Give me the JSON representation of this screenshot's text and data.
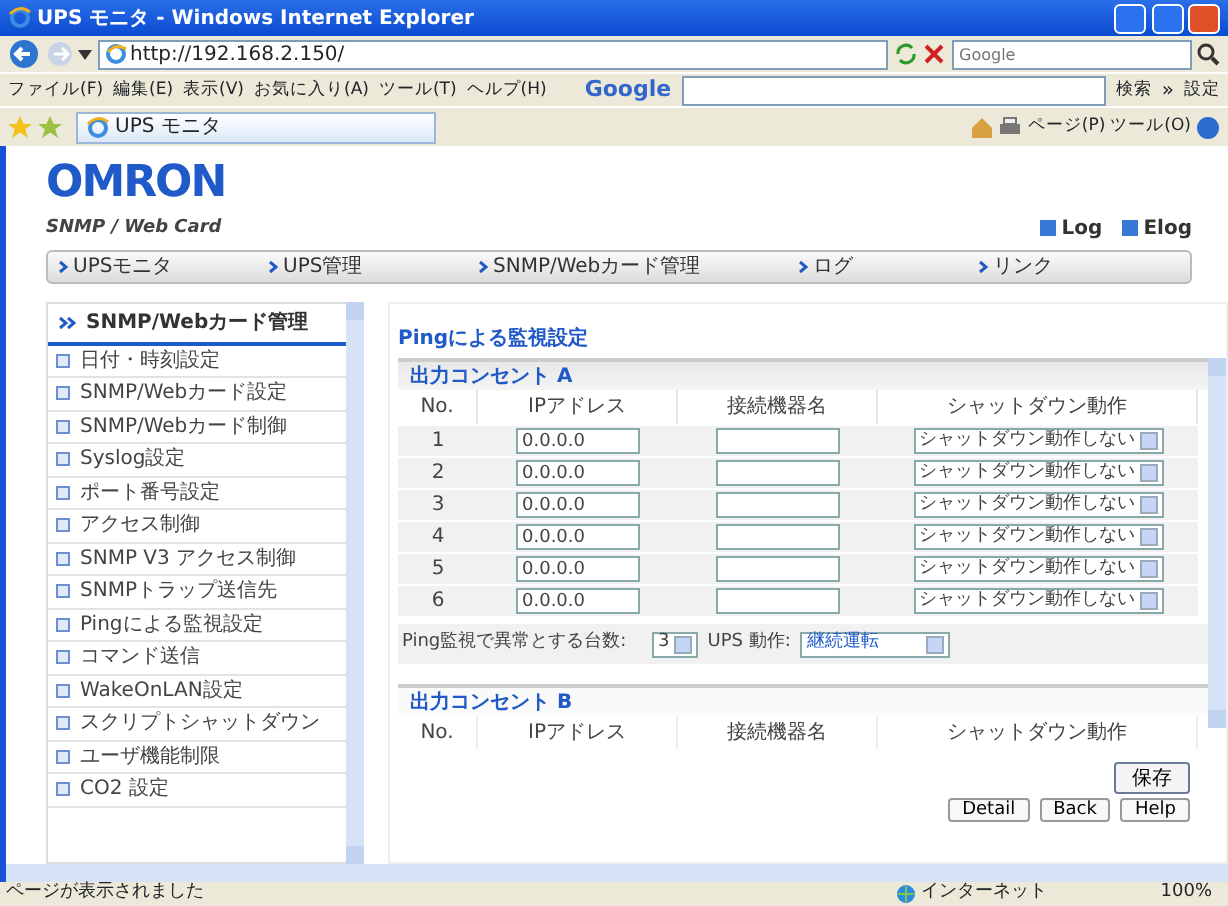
{
  "window": {
    "title": "UPS モニタ - Windows Internet Explorer"
  },
  "address_bar": {
    "url": "http://192.168.2.150/"
  },
  "search": {
    "placeholder": "Google"
  },
  "menu": [
    "ファイル(F)",
    "編集(E)",
    "表示(V)",
    "お気に入り(A)",
    "ツール(T)",
    "ヘルプ(H)"
  ],
  "google_toolbar": {
    "logo": "Google",
    "search_label": "検索",
    "chevron": "»",
    "settings": "設定"
  },
  "tab": {
    "title": "UPS モニタ"
  },
  "command_bar": [
    "ページ(P)",
    "ツール(O)"
  ],
  "page": {
    "logo": "OMRON",
    "subtitle": "SNMP / Web Card",
    "links": [
      "Log",
      "Elog"
    ],
    "nav": [
      "UPSモニタ",
      "UPS管理",
      "SNMP/Webカード管理",
      "ログ",
      "リンク"
    ],
    "sidebar": {
      "header": "SNMP/Webカード管理",
      "items": [
        "日付・時刻設定",
        "SNMP/Webカード設定",
        "SNMP/Webカード制御",
        "Syslog設定",
        "ポート番号設定",
        "アクセス制御",
        "SNMP V3 アクセス制御",
        "SNMPトラップ送信先",
        "Pingによる監視設定",
        "コマンド送信",
        "WakeOnLAN設定",
        "スクリプトシャットダウン",
        "ユーザ機能制限",
        "CO2 設定"
      ]
    },
    "panel": {
      "title": "Pingによる監視設定",
      "section_a": {
        "title": "出力コンセント A",
        "columns": [
          "No.",
          "IPアドレス",
          "接続機器名",
          "シャットダウン動作"
        ],
        "rows": [
          {
            "no": "1",
            "ip": "0.0.0.0",
            "action": "シャットダウン動作しない"
          },
          {
            "no": "2",
            "ip": "0.0.0.0",
            "action": "シャットダウン動作しない"
          },
          {
            "no": "3",
            "ip": "0.0.0.0",
            "action": "シャットダウン動作しない"
          },
          {
            "no": "4",
            "ip": "0.0.0.0",
            "action": "シャットダウン動作しない"
          },
          {
            "no": "5",
            "ip": "0.0.0.0",
            "action": "シャットダウン動作しない"
          },
          {
            "no": "6",
            "ip": "0.0.0.0",
            "action": "シャットダウン動作しない"
          }
        ],
        "threshold_label": "Ping監視で異常とする台数:",
        "threshold_value": "3",
        "ups_action_label": "UPS 動作:",
        "ups_action_value": "継続運転"
      },
      "section_b": {
        "title": "出力コンセント B",
        "columns": [
          "No.",
          "IPアドレス",
          "接続機器名",
          "シャットダウン動作"
        ]
      },
      "save_button": "保存",
      "footer_buttons": [
        "Detail",
        "Back",
        "Help"
      ]
    }
  },
  "status_bar": {
    "text": "ページが表示されました",
    "zone": "インターネット",
    "zoom": "100%"
  }
}
